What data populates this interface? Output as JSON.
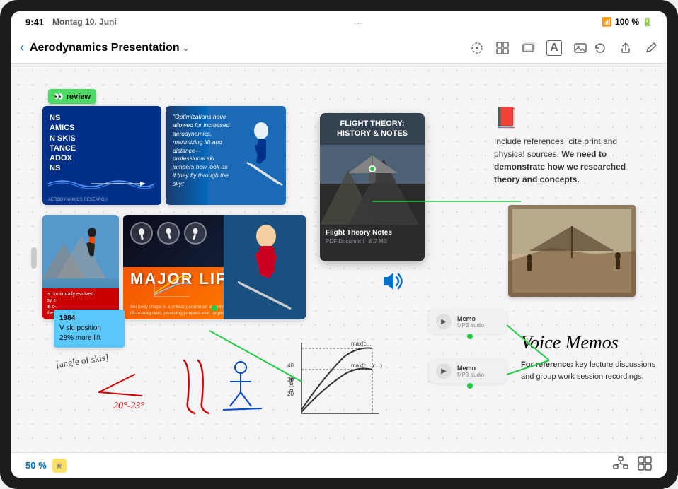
{
  "status_bar": {
    "time": "9:41",
    "day": "Montag 10. Juni",
    "wifi_strength": "100%",
    "battery": "100 %",
    "dots": "..."
  },
  "toolbar": {
    "back_label": "‹",
    "title": "Aerodynamics Presentation",
    "chevron": "⌄",
    "icons": {
      "lasso": "⊙",
      "grid": "⊞",
      "stack": "⧉",
      "text": "A",
      "image": "⊡"
    },
    "right_icons": {
      "history": "↺",
      "share": "⬆",
      "edit": "✏"
    }
  },
  "canvas": {
    "review_sticky": {
      "label": "review",
      "emoji": "👀"
    },
    "slide1": {
      "lines": [
        "NS",
        "AMICS",
        "N SKIS",
        "TANCE",
        "ADOX",
        "NS"
      ],
      "full_title": "AERODYNAMICS IN SKI DISTANCE PARADOX NS"
    },
    "slide2": {
      "quote": "\"Optimizations have allowed for increased aerodynamics, maximizing lift and distance—professional ski jumpers now look as if they fly through the sky.\""
    },
    "slide3": {
      "text": "is continually evolved ay c- le c- ther ther"
    },
    "slide4": {
      "title": "MAJOR LIFT",
      "body": "Ski body shape is a critical parameter: aerodynamics are analyzed to maximize lift-to-drag ratio, providing jumpers ever larger—"
    },
    "pdf_card": {
      "title": "FLIGHT THEORY:\nHISTORY & NOTES",
      "filename": "Flight Theory Notes",
      "type": "PDF Document",
      "size": "8.7 MB"
    },
    "text_note": {
      "icon": "📕",
      "text": "Include references, cite print and physical sources. We need to demonstrate how we researched theory and concepts."
    },
    "blue_sticky": {
      "year": "1984",
      "position": "V ski position",
      "lift": "28% more lift"
    },
    "speaker": {
      "icon": "🔊"
    },
    "memo1": {
      "label": "Memo",
      "type": "MP3 audio"
    },
    "memo2": {
      "label": "Memo",
      "type": "MP3 audio"
    },
    "voice_memos": {
      "title": "Voice Memos",
      "text": "For reference: key lecture discussions and group work session recordings."
    },
    "handwriting": {
      "angle_text": "[angle of skis]",
      "angle_value": "20°-23°"
    }
  },
  "bottom_toolbar": {
    "zoom": "50 %",
    "star_icon": "★",
    "hierarchy_icon": "⊤",
    "grid_icon": "⊞"
  }
}
